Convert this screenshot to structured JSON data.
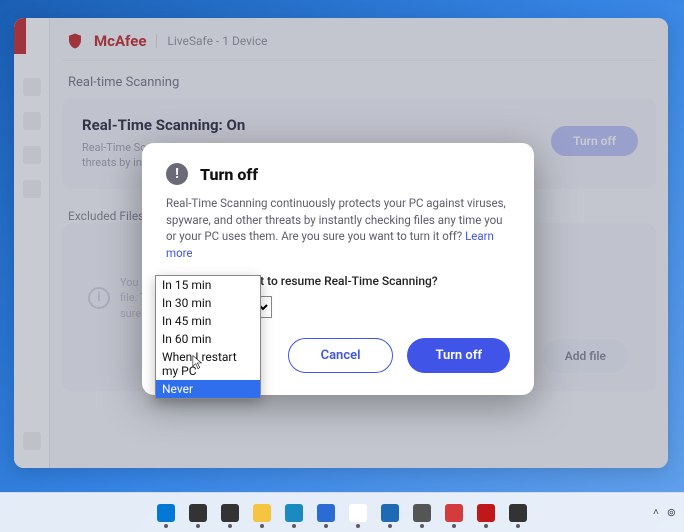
{
  "app": {
    "brand": "McAfee",
    "product_line": "LiveSafe - 1 Device"
  },
  "page": {
    "breadcrumb": "Real-time Scanning"
  },
  "rts_card": {
    "title": "Real-Time Scanning: On",
    "desc": "Real-Time Scanning continuously protects your PC against viruses, spyware, and other threats by instantly checking files any time you or your PC uses them.",
    "button": "Turn off"
  },
  "excluded": {
    "label": "Excluded Files",
    "info_text": "You haven't excluded any files from Real-Time Scanning. To exclude a file, click Add file. To check excluded files, you can run a custom scan from the Home page. Not sure if a file is a threat? Submit it to us.",
    "add_button": "Add file"
  },
  "modal": {
    "title": "Turn off",
    "body": "Real-Time Scanning continuously protects your PC against viruses, spyware, and other threats by instantly checking files any time you or your PC uses them. Are you sure you want to turn it off? ",
    "learn_more": "Learn more",
    "prompt": "When do you want to resume Real-Time Scanning?",
    "selected": "In 15 min",
    "options": [
      "In 15 min",
      "In 30 min",
      "In 45 min",
      "In 60 min",
      "When I restart my PC",
      "Never"
    ],
    "highlighted_index": 5,
    "cancel": "Cancel",
    "confirm": "Turn off"
  },
  "taskbar": {
    "items": [
      {
        "name": "start-icon",
        "color": "#0078d4"
      },
      {
        "name": "search-icon",
        "color": "#333"
      },
      {
        "name": "task-view-icon",
        "color": "#333"
      },
      {
        "name": "explorer-icon",
        "color": "#f5c542"
      },
      {
        "name": "edge-icon",
        "color": "#1a8ac1"
      },
      {
        "name": "store-icon",
        "color": "#2a6bd4"
      },
      {
        "name": "mail-icon",
        "color": "#ffffff"
      },
      {
        "name": "photos-icon",
        "color": "#1f6ab5"
      },
      {
        "name": "settings-icon",
        "color": "#555"
      },
      {
        "name": "app-icon",
        "color": "#d23c3c"
      },
      {
        "name": "mcafee-tray-icon",
        "color": "#c01818"
      },
      {
        "name": "terminal-icon",
        "color": "#333"
      }
    ]
  }
}
